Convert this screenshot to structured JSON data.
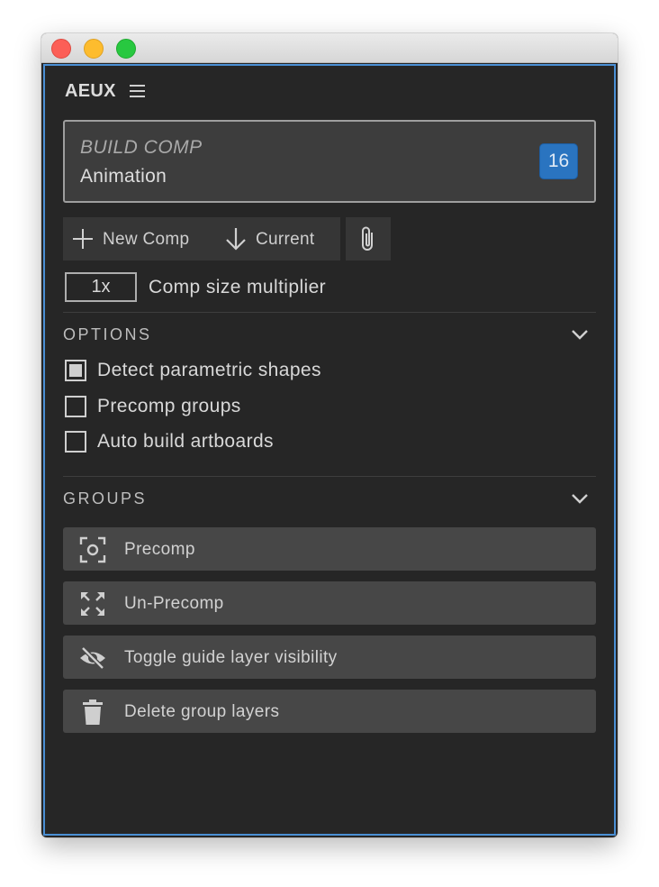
{
  "header": {
    "title": "AEUX"
  },
  "build": {
    "label": "BUILD COMP",
    "comp_name": "Animation",
    "count": "16"
  },
  "toolbar": {
    "new_comp_label": "New Comp",
    "current_label": "Current"
  },
  "multiplier": {
    "value": "1x",
    "label": "Comp size multiplier"
  },
  "options": {
    "title": "OPTIONS",
    "items": [
      {
        "label": "Detect parametric shapes",
        "checked": true
      },
      {
        "label": "Precomp groups",
        "checked": false
      },
      {
        "label": "Auto build artboards",
        "checked": false
      }
    ]
  },
  "groups": {
    "title": "GROUPS",
    "buttons": [
      {
        "label": "Precomp",
        "icon": "precomp-focus-icon"
      },
      {
        "label": "Un-Precomp",
        "icon": "expand-arrows-icon"
      },
      {
        "label": "Toggle guide layer visibility",
        "icon": "eye-slash-icon"
      },
      {
        "label": "Delete group layers",
        "icon": "trash-icon"
      }
    ]
  },
  "colors": {
    "panel_bg": "#262626",
    "accent_blue": "#2a74c0",
    "focus_border": "#4a8fd4",
    "button_bg": "#474747"
  }
}
